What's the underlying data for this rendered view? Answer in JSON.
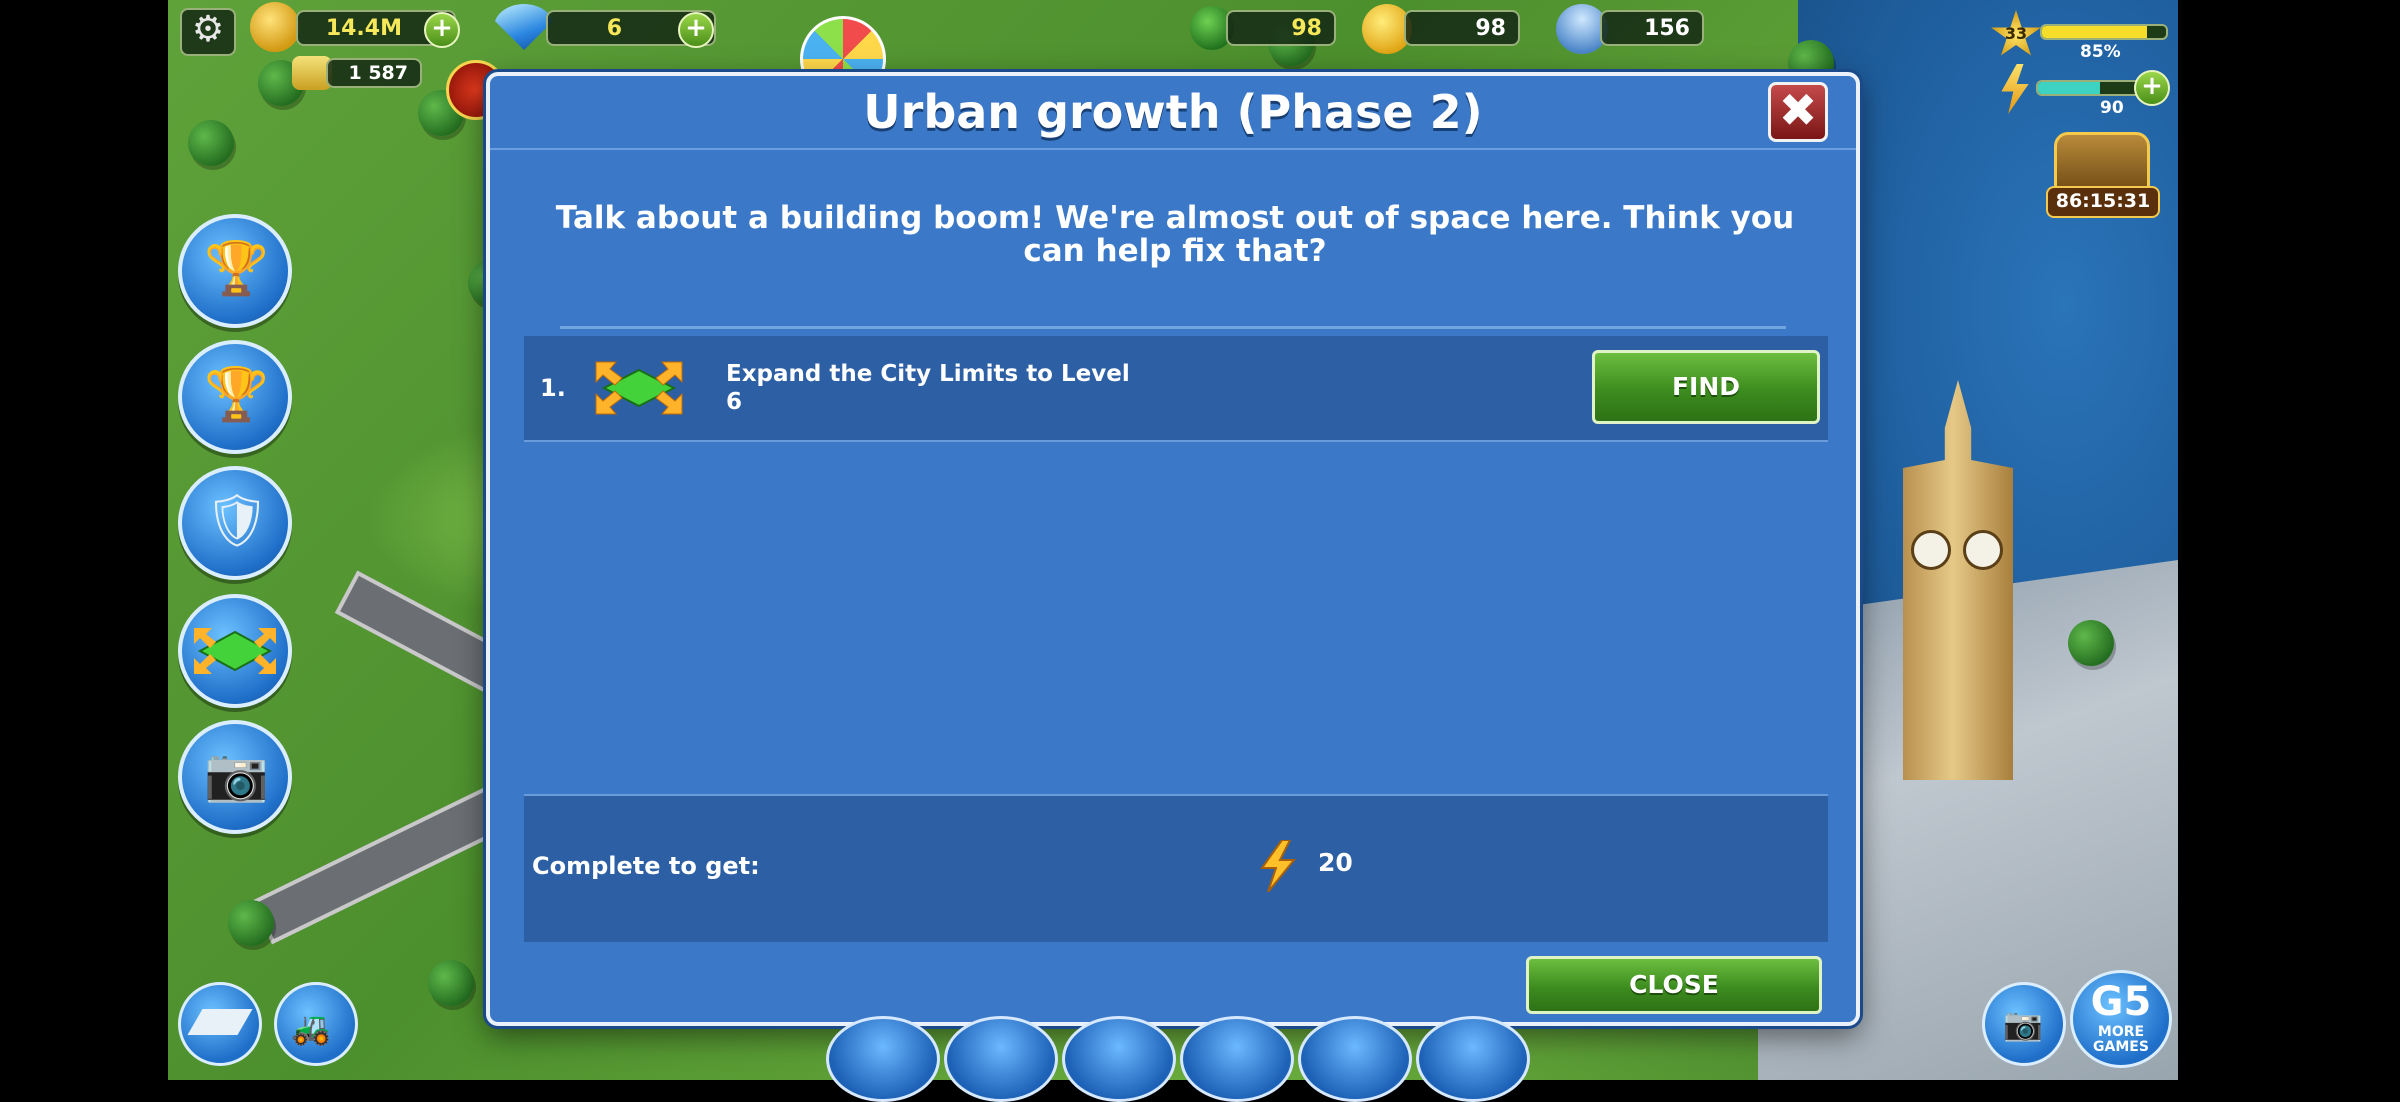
{
  "hud": {
    "coins": "14.4M",
    "gems": "6",
    "secondary_currency": "1 587",
    "trees": "98",
    "happiness": "98",
    "population": "156",
    "level": "33",
    "xp_percent_text": "85%",
    "xp_fraction": 0.85,
    "energy": "90",
    "energy_fraction": 0.6,
    "chest_timer": "86:15:31"
  },
  "dialog": {
    "title": "Urban growth (Phase 2)",
    "description": "Talk about a building boom! We're almost out of space here. Think you can help fix that?",
    "tasks": [
      {
        "number": "1.",
        "text": "Expand the City Limits to Level 6",
        "button": "FIND"
      }
    ],
    "reward_label": "Complete to get:",
    "reward_value": "20",
    "close_button": "CLOSE",
    "close_icon_glyph": "✖"
  },
  "branding": {
    "logo": "G5",
    "more_games": "MORE GAMES"
  },
  "colors": {
    "dialog_bg": "#3b79c8",
    "panel_bg": "#2d5fa5",
    "button_green": "#3d8c1f",
    "xp_bar": "#f5dd2a",
    "energy_bar": "#3dd3c3"
  }
}
